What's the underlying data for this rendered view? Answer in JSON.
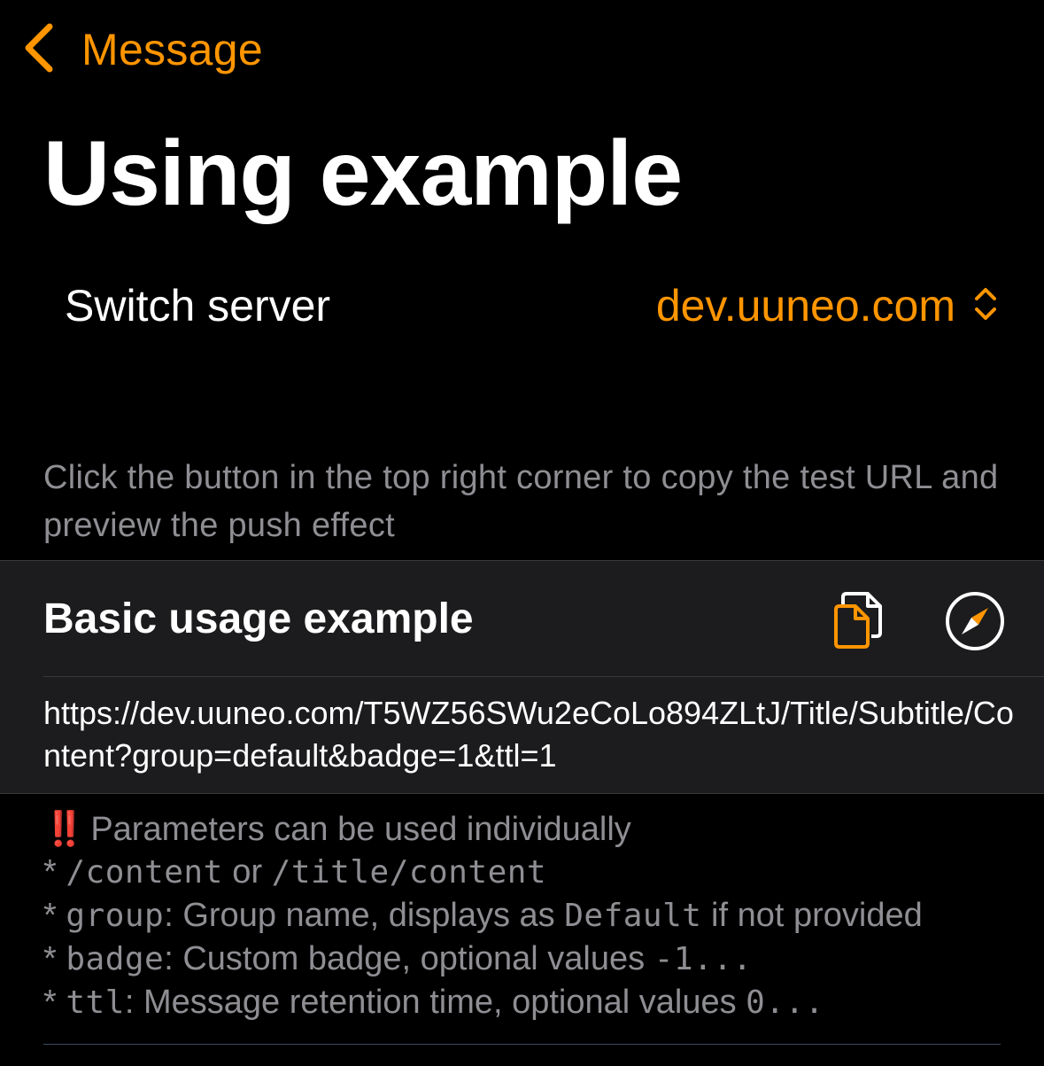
{
  "nav": {
    "back_label": "Message",
    "back_icon": "chevron-left-icon"
  },
  "title": "Using example",
  "server": {
    "label": "Switch server",
    "value": "dev.uuneo.com",
    "picker_icon": "chevron-up-down-icon"
  },
  "hint": "Click the button in the top right corner to copy the test URL and preview the push effect",
  "card": {
    "title": "Basic usage example",
    "copy_icon": "copy-document-icon",
    "preview_icon": "safari-compass-icon",
    "url": "https://dev.uuneo.com/T5WZ56SWu2eCoLo894ZLtJ/Title/Subtitle/Content?group=default&badge=1&ttl=1"
  },
  "notes": {
    "warning_icon": "‼️",
    "heading": "Parameters can be used individually",
    "line1": {
      "bullet": "* ",
      "code1": "/content",
      "text": " or ",
      "code2": "/title/content"
    },
    "line2": {
      "bullet": "* ",
      "code1": "group",
      "text1": ": Group name, displays as ",
      "code2": "Default",
      "text2": " if not provided"
    },
    "line3": {
      "bullet": "* ",
      "code1": "badge",
      "text1": ": Custom badge, optional values ",
      "code2": "-1..."
    },
    "line4": {
      "bullet": "* ",
      "code1": "ttl",
      "text1": ": Message retention time, optional values ",
      "code2": "0..."
    }
  },
  "colors": {
    "accent": "#ff9500",
    "background": "#000000",
    "card": "#1c1c1e",
    "secondary_text": "#8e8e93",
    "warning": "#ff3b30"
  }
}
